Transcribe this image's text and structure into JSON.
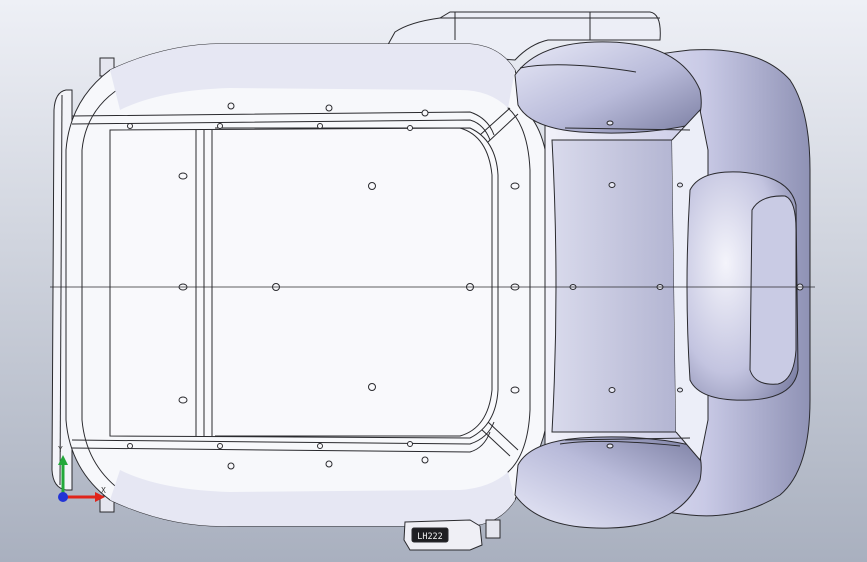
{
  "app": {
    "title": ""
  },
  "viewport": {
    "background_top": "#eef0f6",
    "background_bottom": "#a9b0bf",
    "model_fill": "#f7f8fb",
    "model_shadow": "#cfd2e6",
    "model_deep_shadow": "#8e92b0",
    "edge_color": "#2a2a2e"
  },
  "model": {
    "label_plate_text": "LH222"
  },
  "triad": {
    "x_label": "X",
    "y_label": "Y",
    "x_color": "#e0241b",
    "y_color": "#22a83a",
    "z_color": "#2233d6"
  },
  "icons": {
    "triad": "coordinate-triad-icon"
  }
}
